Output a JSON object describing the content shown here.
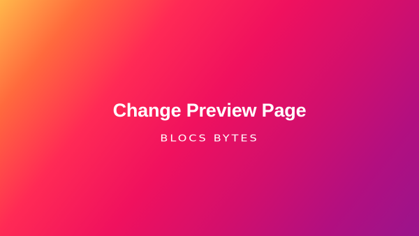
{
  "hero": {
    "title": "Change Preview Page",
    "brand": "BLOCS BYTES"
  },
  "colors": {
    "gradient_start": "#ffb84a",
    "gradient_mid": "#f0115e",
    "gradient_end": "#9a148c",
    "text": "#ffffff"
  }
}
